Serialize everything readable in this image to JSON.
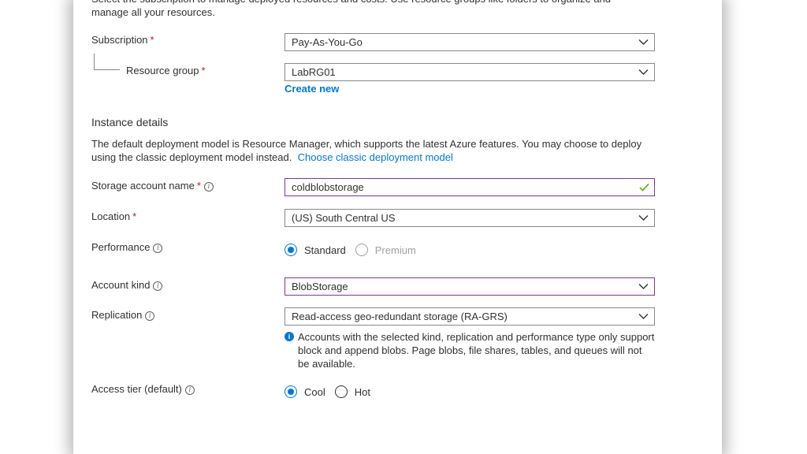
{
  "intro": {
    "text": "Select the subscription to manage deployed resources and costs. Use resource groups like folders to organize and manage all your resources."
  },
  "subscription": {
    "label": "Subscription",
    "required_mark": "*",
    "value": "Pay-As-You-Go"
  },
  "resource_group": {
    "label": "Resource group",
    "required_mark": "*",
    "value": "LabRG01",
    "create_new": "Create new"
  },
  "instance": {
    "title": "Instance details",
    "description": "The default deployment model is Resource Manager, which supports the latest Azure features. You may choose to deploy using the classic deployment model instead.",
    "classic_link": "Choose classic deployment model"
  },
  "storage_name": {
    "label": "Storage account name",
    "required_mark": "*",
    "info": "i",
    "value": "coldblobstorage",
    "valid": true
  },
  "location": {
    "label": "Location",
    "required_mark": "*",
    "value": "(US) South Central US"
  },
  "performance": {
    "label": "Performance",
    "info": "i",
    "options": [
      {
        "label": "Standard",
        "selected": true,
        "disabled": false
      },
      {
        "label": "Premium",
        "selected": false,
        "disabled": true
      }
    ]
  },
  "account_kind": {
    "label": "Account kind",
    "info": "i",
    "value": "BlobStorage"
  },
  "replication": {
    "label": "Replication",
    "info": "i",
    "value": "Read-access geo-redundant storage (RA-GRS)",
    "note_icon": "i",
    "note": "Accounts with the selected kind, replication and performance type only support block and append blobs. Page blobs, file shares, tables, and queues will not be available."
  },
  "access_tier": {
    "label": "Access tier (default)",
    "info": "i",
    "options": [
      {
        "label": "Cool",
        "selected": true
      },
      {
        "label": "Hot",
        "selected": false
      }
    ]
  },
  "colors": {
    "accent": "#0078d4",
    "focus_border": "#8a2da5",
    "required": "#a4262c",
    "valid": "#57a300"
  }
}
